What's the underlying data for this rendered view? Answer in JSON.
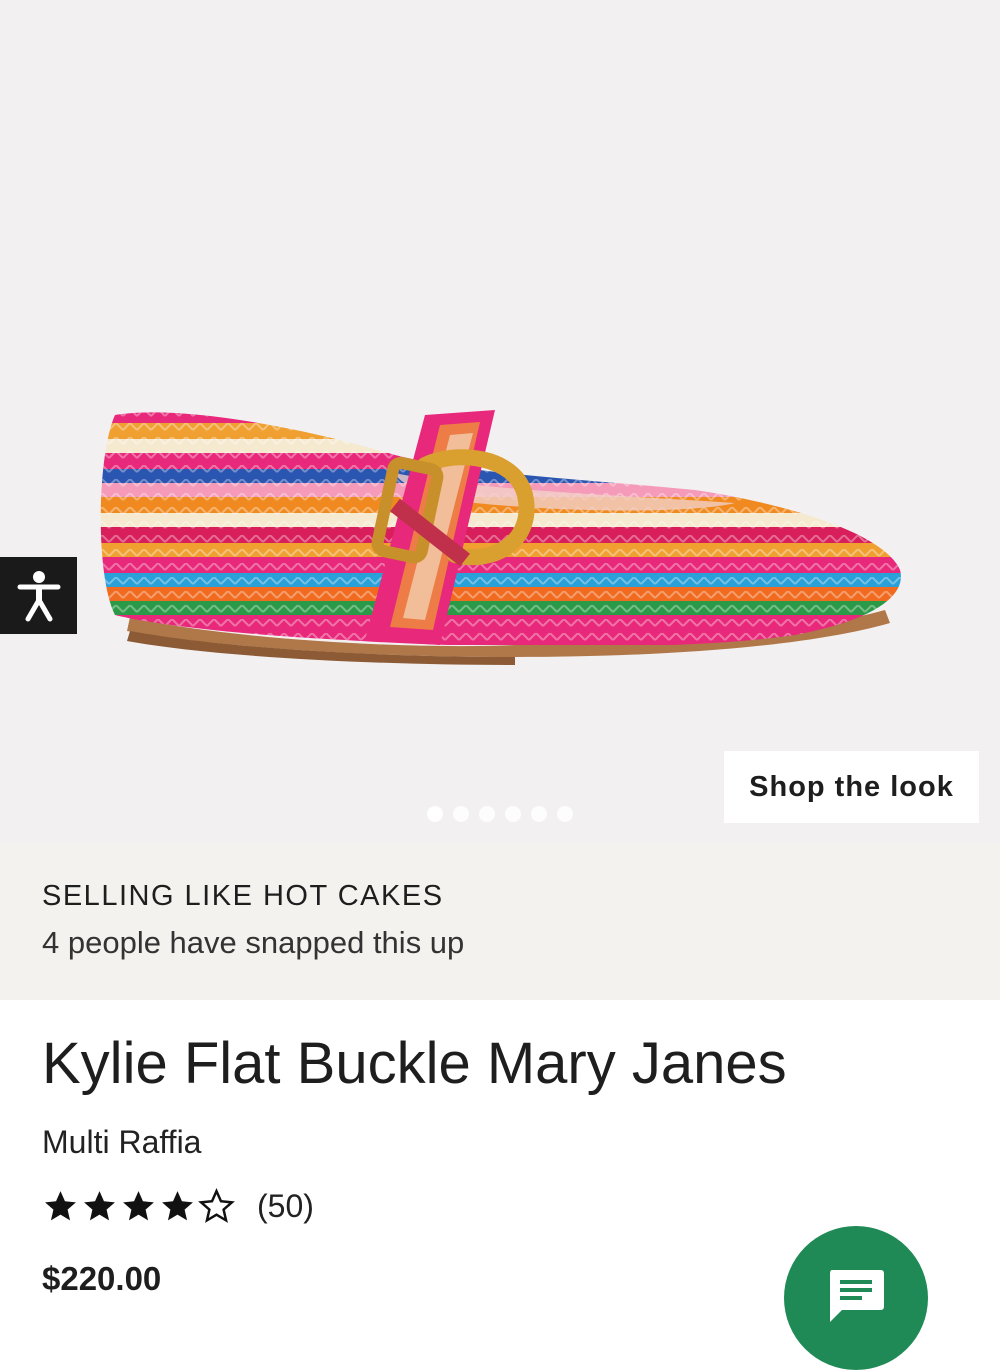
{
  "gallery": {
    "shop_the_look_label": "Shop the look",
    "dot_count": 6,
    "active_dot": 1
  },
  "promo": {
    "title": "SELLING LIKE HOT CAKES",
    "subtitle": "4 people have snapped this up"
  },
  "product": {
    "title": "Kylie Flat Buckle Mary Janes",
    "color": "Multi Raffia",
    "rating": 4,
    "rating_max": 5,
    "review_count": "(50)",
    "price": "$220.00"
  },
  "icons": {
    "accessibility": "accessibility-icon",
    "chat": "chat-icon"
  },
  "colors": {
    "chat_button": "#1f8a55",
    "accessibility_button": "#1a1a1a"
  }
}
